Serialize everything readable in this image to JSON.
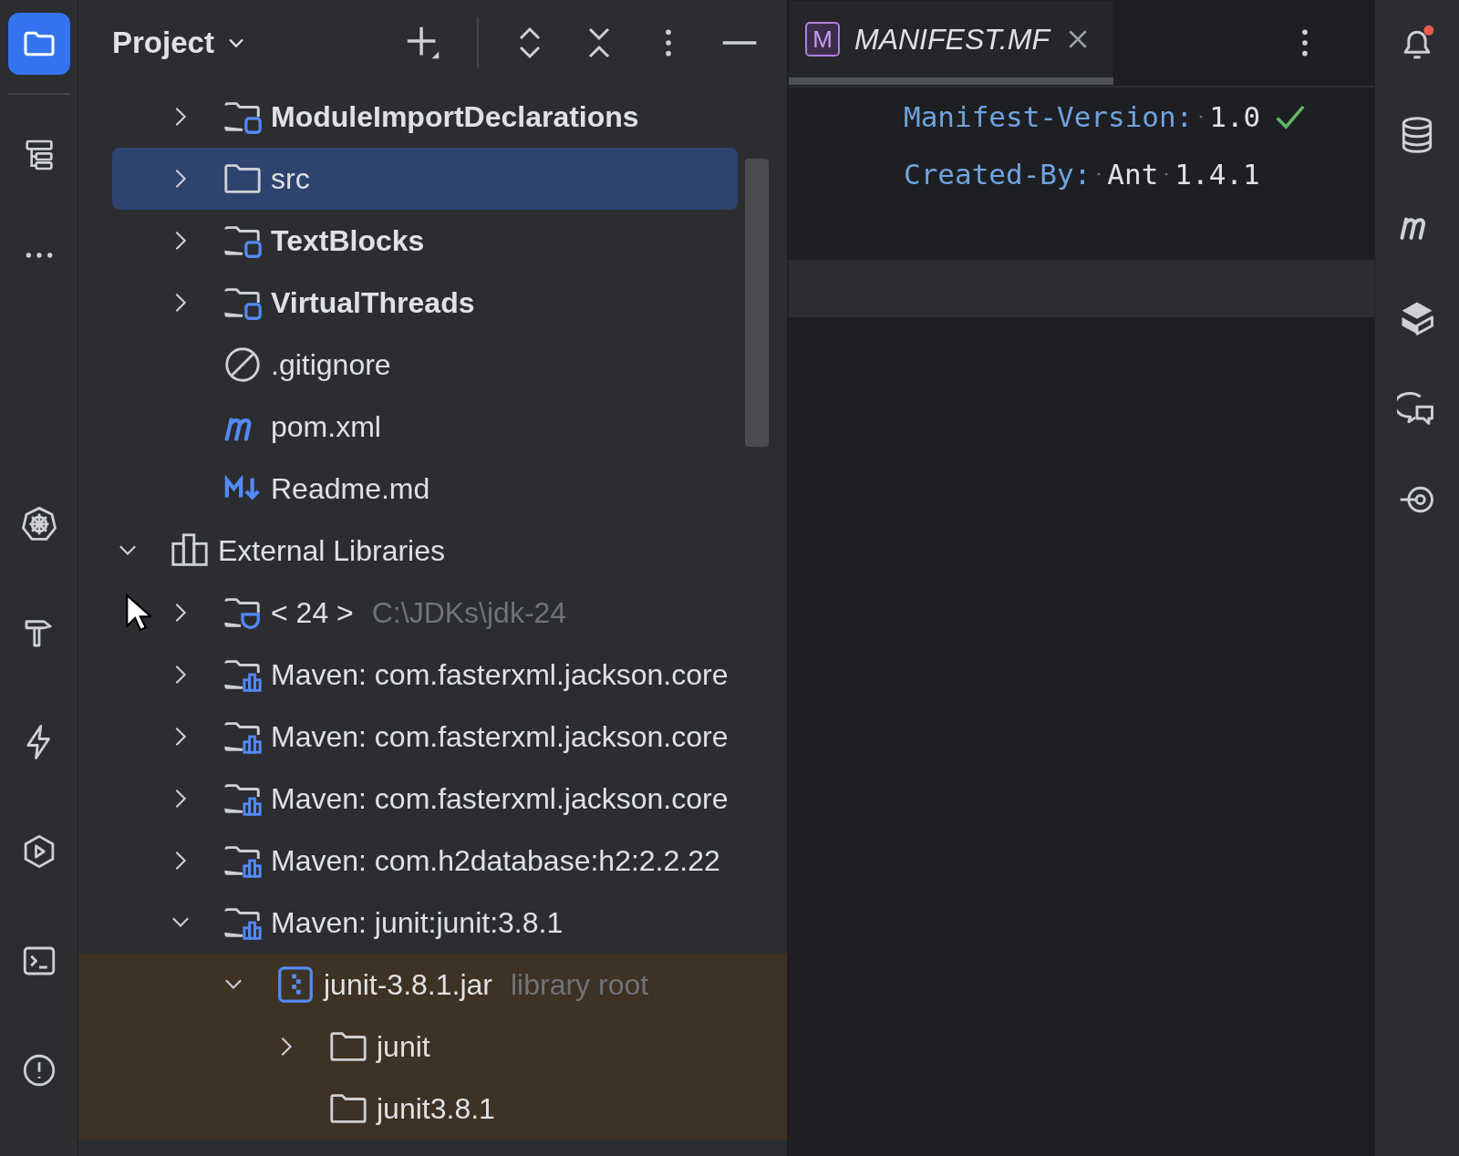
{
  "left_toolbar": {
    "items": [
      {
        "kind": "project",
        "selected": true
      },
      {
        "kind": "structure",
        "selected": false
      },
      {
        "kind": "more",
        "selected": false
      }
    ],
    "bottom_items": [
      {
        "kind": "kubernetes"
      },
      {
        "kind": "build"
      },
      {
        "kind": "services"
      },
      {
        "kind": "run"
      },
      {
        "kind": "terminal"
      },
      {
        "kind": "problems"
      }
    ]
  },
  "project_panel": {
    "title": "Project",
    "tree": [
      {
        "children": [
          {
            "kind": "module",
            "label": "ModuleImportDeclarations",
            "expanded": false,
            "selected": false,
            "highlighted": false
          },
          {
            "kind": "folder",
            "label": "src",
            "expanded": false,
            "selected": true,
            "highlighted": false
          },
          {
            "kind": "module",
            "label": "TextBlocks",
            "expanded": false,
            "selected": false,
            "highlighted": false
          },
          {
            "kind": "module",
            "label": "VirtualThreads",
            "expanded": false,
            "selected": false,
            "highlighted": false
          },
          {
            "kind": "ignore",
            "label": ".gitignore",
            "selected": false,
            "highlighted": false
          },
          {
            "kind": "maven",
            "label": "pom.xml",
            "selected": false,
            "highlighted": false
          },
          {
            "kind": "markdown",
            "label": "Readme.md",
            "selected": false,
            "highlighted": false
          }
        ]
      },
      {
        "kind": "libraries",
        "label": "External Libraries",
        "expanded": true,
        "selected": false,
        "highlighted": false,
        "children": [
          {
            "kind": "jdk",
            "label": "< 24 >",
            "hint": "C:\\JDKs\\jdk-24",
            "expanded": false,
            "selected": false,
            "highlighted": false
          },
          {
            "kind": "library",
            "label": "Maven: com.fasterxml.jackson.core",
            "expanded": false,
            "selected": false,
            "highlighted": false
          },
          {
            "kind": "library",
            "label": "Maven: com.fasterxml.jackson.core",
            "expanded": false,
            "selected": false,
            "highlighted": false
          },
          {
            "kind": "library",
            "label": "Maven: com.fasterxml.jackson.core",
            "expanded": false,
            "selected": false,
            "highlighted": false
          },
          {
            "kind": "library",
            "label": "Maven: com.h2database:h2:2.2.22",
            "expanded": false,
            "selected": false,
            "highlighted": false
          },
          {
            "kind": "library",
            "label": "Maven: junit:junit:3.8.1",
            "expanded": true,
            "selected": false,
            "highlighted": false,
            "children": [
              {
                "kind": "jar",
                "label": "junit-3.8.1.jar",
                "hint": "library root",
                "expanded": true,
                "selected": false,
                "highlighted": true,
                "children": [
                  {
                    "kind": "folder",
                    "label": "junit",
                    "expanded": false,
                    "selected": false,
                    "highlighted": true
                  },
                  {
                    "kind": "folder",
                    "label": "junit3.8.1",
                    "selected": false,
                    "highlighted": true
                  }
                ]
              }
            ]
          }
        ]
      }
    ]
  },
  "editor": {
    "tab": {
      "label": "MANIFEST.MF",
      "badge": "M"
    },
    "inspection_ok": true,
    "lines": [
      {
        "key": "Manifest-Version:",
        "words": [
          "1.0"
        ]
      },
      {
        "key": "Created-By:",
        "words": [
          "Ant",
          "1.4.1"
        ]
      }
    ],
    "current_line_highlight": true
  },
  "right_toolbar": {
    "items": [
      {
        "kind": "notifications",
        "unread": true
      },
      {
        "kind": "database"
      },
      {
        "kind": "maven"
      },
      {
        "kind": "plugin"
      },
      {
        "kind": "ai-chat"
      },
      {
        "kind": "commit"
      }
    ]
  }
}
